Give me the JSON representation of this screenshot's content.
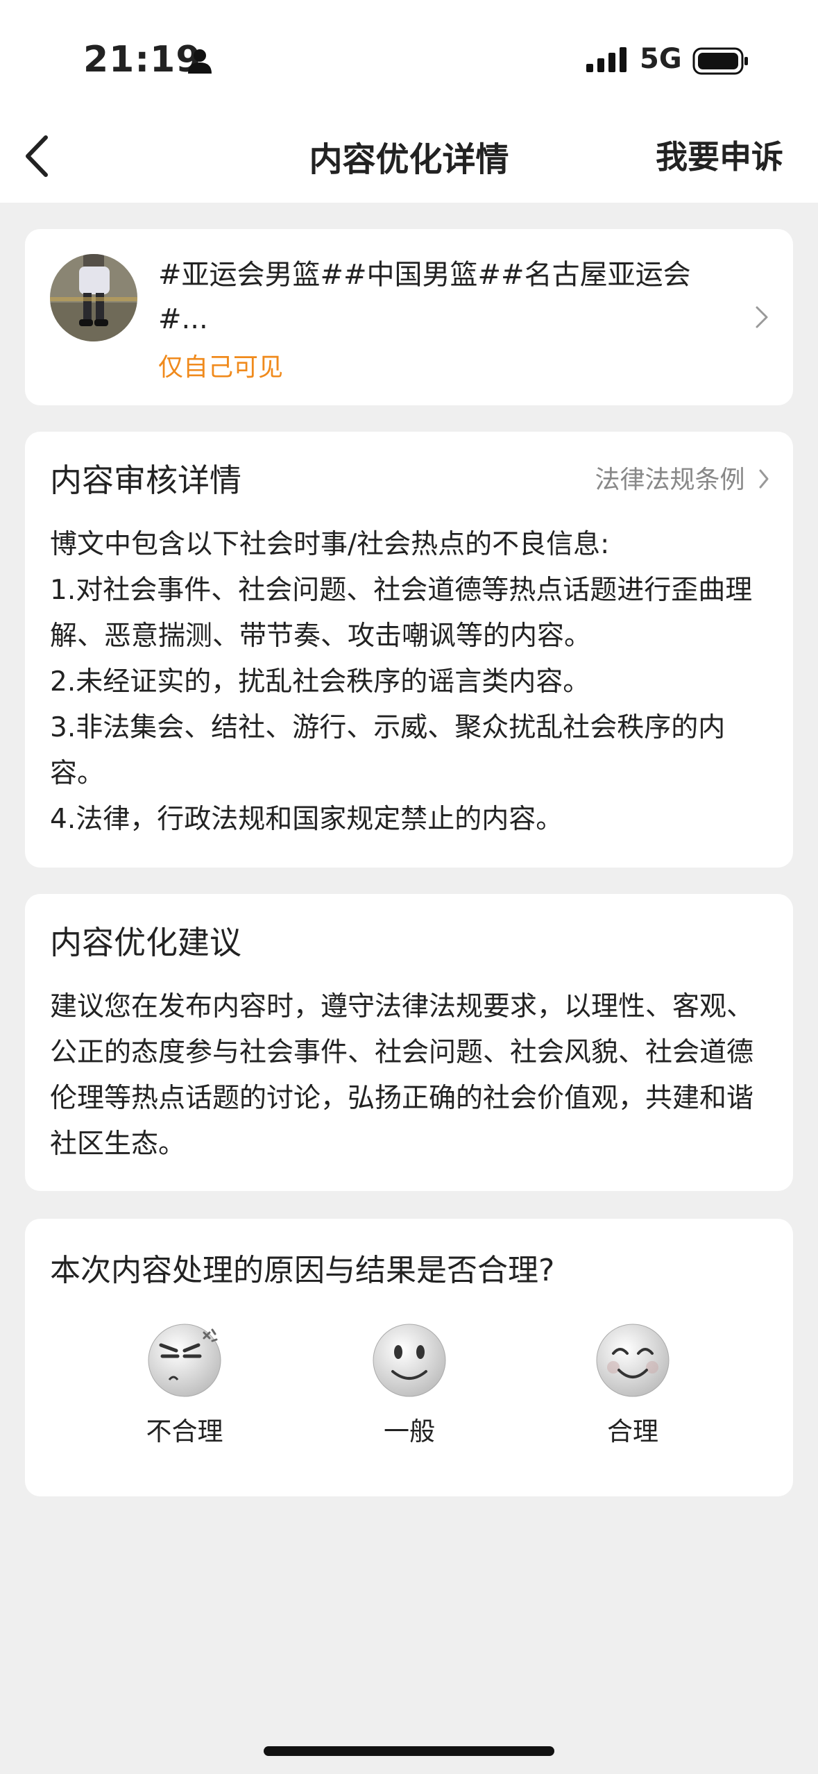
{
  "status_bar": {
    "time": "21:19",
    "network": "5G",
    "icons": [
      "person-icon",
      "signal-icon",
      "battery-icon"
    ]
  },
  "nav": {
    "back_icon": "chevron-left-icon",
    "title": "内容优化详情",
    "appeal_label": "我要申诉"
  },
  "post": {
    "text": "#亚运会男篮##中国男篮##名古屋亚运会#...",
    "visibility": "仅自己可见",
    "visibility_color": "#f08a1c"
  },
  "review": {
    "title": "内容审核详情",
    "law_link": "法律法规条例",
    "lines": [
      "博文中包含以下社会时事/社会热点的不良信息:",
      "1.对社会事件、社会问题、社会道德等热点话题进行歪曲理解、恶意揣测、带节奏、攻击嘲讽等的内容。",
      "2.未经证实的，扰乱社会秩序的谣言类内容。",
      "3.非法集会、结社、游行、示威、聚众扰乱社会秩序的内容。",
      "4.法律，行政法规和国家规定禁止的内容。"
    ]
  },
  "suggestion": {
    "title": "内容优化建议",
    "text": "建议您在发布内容时，遵守法律法规要求，以理性、客观、公正的态度参与社会事件、社会问题、社会风貌、社会道德伦理等热点话题的讨论，弘扬正确的社会价值观，共建和谐社区生态。"
  },
  "feedback": {
    "question": "本次内容处理的原因与结果是否合理?",
    "options": [
      {
        "label": "不合理",
        "icon": "angry-face-icon"
      },
      {
        "label": "一般",
        "icon": "neutral-face-icon"
      },
      {
        "label": "合理",
        "icon": "happy-face-icon"
      }
    ]
  }
}
